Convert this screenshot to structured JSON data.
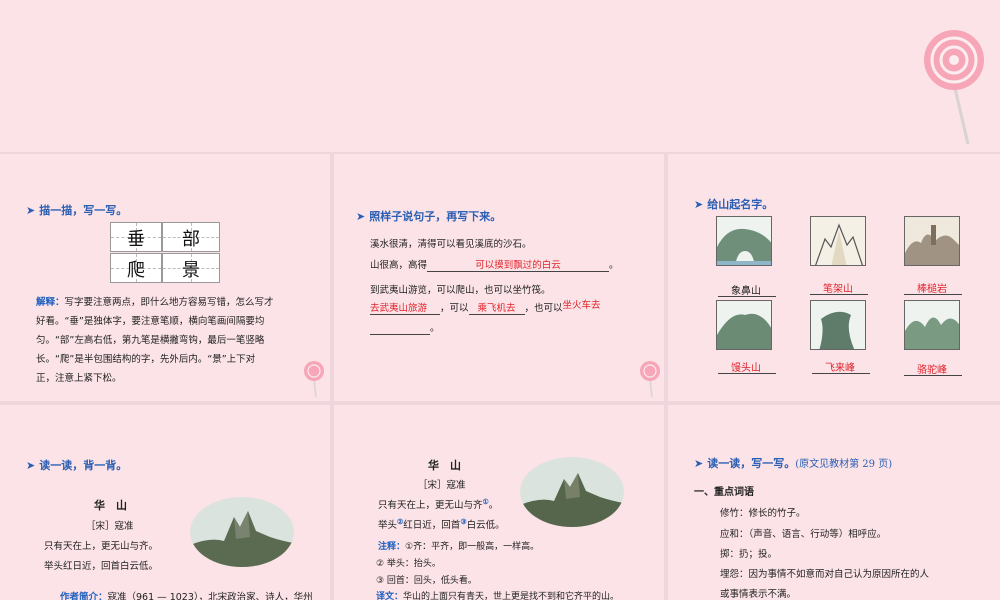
{
  "colors": {
    "title_blue": "#2b5fb3",
    "answer_red": "#e0242a",
    "background": "#fbe3e8"
  },
  "panel1": {
    "title": "描一描，写一写。",
    "chars": [
      "垂",
      "部",
      "爬",
      "景"
    ],
    "note_label": "解释：",
    "note_lines": [
      "写字要注意两点，即什么地方容易写错，怎么写才",
      "好看。“垂”是独体字，要注意笔顺，横向笔画间隔要均",
      "匀。“部”左高右低，第九笔是横撇弯钩，最后一笔竖略",
      "长。“爬”是半包围结构的字，先外后内。“景”上下对",
      "正，注意上紧下松。"
    ]
  },
  "panel2": {
    "title": "照样子说句子，再写下来。",
    "example": "溪水很清，清得可以看见溪底的沙石。",
    "line2_prefix": "山很高，高得",
    "line2_answer": "可以摸到飘过的白云",
    "line2_end": "。",
    "example2": "到武夷山游览，可以爬山，也可以坐竹筏。",
    "ans_a": "去武夷山旅游",
    "mid_a": "，可以",
    "ans_b": "乘飞机去",
    "mid_b": "，也可以",
    "ans_c": "坐火车去",
    "end": "。"
  },
  "panel3": {
    "title": "给山起名字。",
    "names": [
      "象鼻山",
      "笔架山",
      "棒槌岩",
      "馒头山",
      "飞来峰",
      "骆驼峰"
    ]
  },
  "panel4": {
    "title": "读一读，背一背。",
    "poem_title": "华　山",
    "author": "［宋］寇准",
    "lines": [
      "只有天在上，更无山与齐。",
      "举头红日近，回首白云低。"
    ],
    "intro_label": "作者简介：",
    "intro_text": "寇准（961 — 1023），北宋政治家、诗人，华州"
  },
  "panel5": {
    "poem_title": "华　山",
    "author": "［宋］寇准",
    "line1": "只有天在上，更无山与齐",
    "line1_mark": "①",
    "line1_end": "。",
    "line2_a": "举头",
    "mark2": "②",
    "line2_b": "红日近，回首",
    "mark3": "③",
    "line2_c": "白云低。",
    "notes_label": "注释：",
    "notes": [
      "①齐：平齐，即一般高，一样高。",
      "② 举头：抬头。",
      "③ 回首：回头，低头看。"
    ],
    "trans_label": "译文：",
    "trans": "华山的上面只有青天，世上更是找不到和它齐平的山。"
  },
  "panel6": {
    "title": "读一读，写一写。",
    "title_note": "(原文见教材第 29 页)",
    "section": "一、重点词语",
    "items": [
      "修竹：修长的竹子。",
      "应和：（声音、语言、行动等）相呼应。",
      "掷：扔；投。",
      "埋怨：因为事情不如意而对自己认为原因所在的人",
      "或事情表示不满。"
    ]
  }
}
